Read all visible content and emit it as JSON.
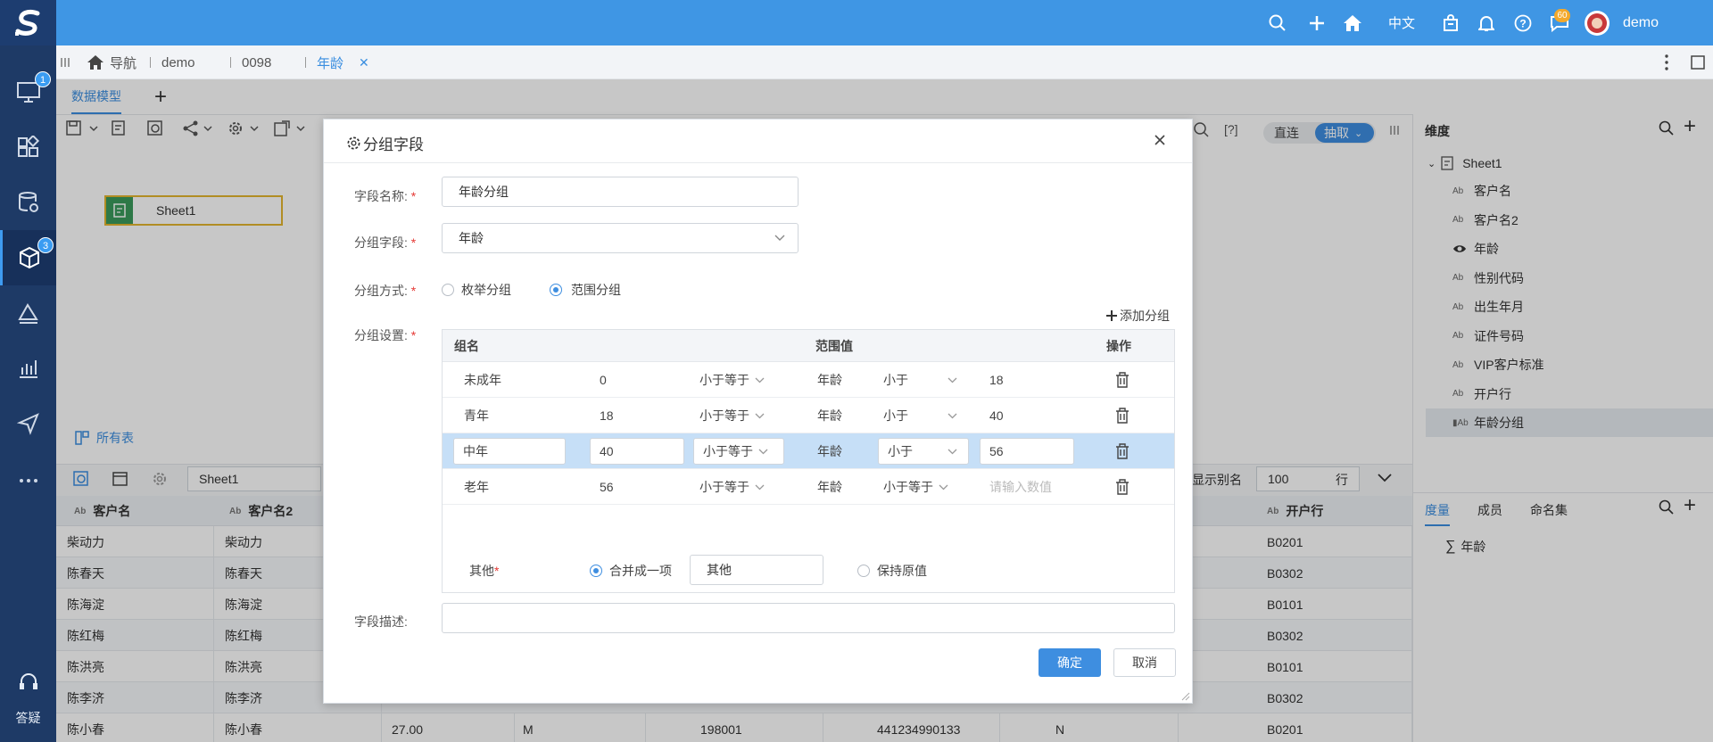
{
  "rail": {
    "badges": {
      "monitor": "1",
      "model": "3"
    },
    "help_label": "答疑"
  },
  "topbar": {
    "lang": "中文",
    "msg_badge": "60",
    "user": "demo"
  },
  "tabs": {
    "nav": "导航",
    "t1": "demo",
    "t2": "0098",
    "t3": "年龄"
  },
  "subtab": {
    "label": "数据模型"
  },
  "canvas": {
    "node_label": "Sheet1",
    "all_tables": "所有表"
  },
  "toolbar_right": {
    "direct": "直连",
    "extract": "抽取",
    "help": "[?]"
  },
  "bottom_bar": {
    "sheet_name": "Sheet1",
    "show_alias": "显示别名",
    "rows": "100",
    "rows_unit": "行"
  },
  "data_table": {
    "headers": [
      "客户名",
      "客户名2",
      "开户行"
    ],
    "rows": [
      [
        "柴动力",
        "柴动力",
        "B0201"
      ],
      [
        "陈春天",
        "陈春天",
        "B0302"
      ],
      [
        "陈海淀",
        "陈海淀",
        "B0101"
      ],
      [
        "陈红梅",
        "陈红梅",
        "B0302"
      ],
      [
        "陈洪亮",
        "陈洪亮",
        "B0101"
      ],
      [
        "陈李济",
        "陈李济",
        "B0302"
      ],
      [
        "陈小春",
        "陈小春",
        "B0201"
      ]
    ],
    "last_row_extra": [
      "27.00",
      "M",
      "198001",
      "441234990133",
      "N"
    ]
  },
  "right_panel": {
    "title": "维度",
    "root": "Sheet1",
    "fields": [
      "客户名",
      "客户名2",
      "年龄",
      "性别代码",
      "出生年月",
      "证件号码",
      "VIP客户标准",
      "开户行",
      "年龄分组"
    ],
    "tabs": [
      "度量",
      "成员",
      "命名集"
    ],
    "measure": "年龄"
  },
  "dialog": {
    "title": "分组字段",
    "field_name_label": "字段名称:",
    "field_name_value": "年龄分组",
    "group_field_label": "分组字段:",
    "group_field_value": "年龄",
    "method_label": "分组方式:",
    "method_enum": "枚举分组",
    "method_range": "范围分组",
    "settings_label": "分组设置:",
    "add_group": "添加分组",
    "grid_headers": {
      "name": "组名",
      "range": "范围值",
      "ops": "操作"
    },
    "groups": [
      {
        "name": "未成年",
        "low": "0",
        "op1": "小于等于",
        "field": "年龄",
        "op2": "小于",
        "high": "18"
      },
      {
        "name": "青年",
        "low": "18",
        "op1": "小于等于",
        "field": "年龄",
        "op2": "小于",
        "high": "40"
      },
      {
        "name": "中年",
        "low": "40",
        "op1": "小于等于",
        "field": "年龄",
        "op2": "小于",
        "high": "56"
      },
      {
        "name": "老年",
        "low": "56",
        "op1": "小于等于",
        "field": "年龄",
        "op2": "小于等于",
        "high": ""
      }
    ],
    "high_placeholder": "请输入数值",
    "other_label": "其他",
    "merge_label": "合并成一项",
    "merge_value": "其他",
    "keep_label": "保持原值",
    "desc_label": "字段描述:",
    "ok": "确定",
    "cancel": "取消"
  }
}
